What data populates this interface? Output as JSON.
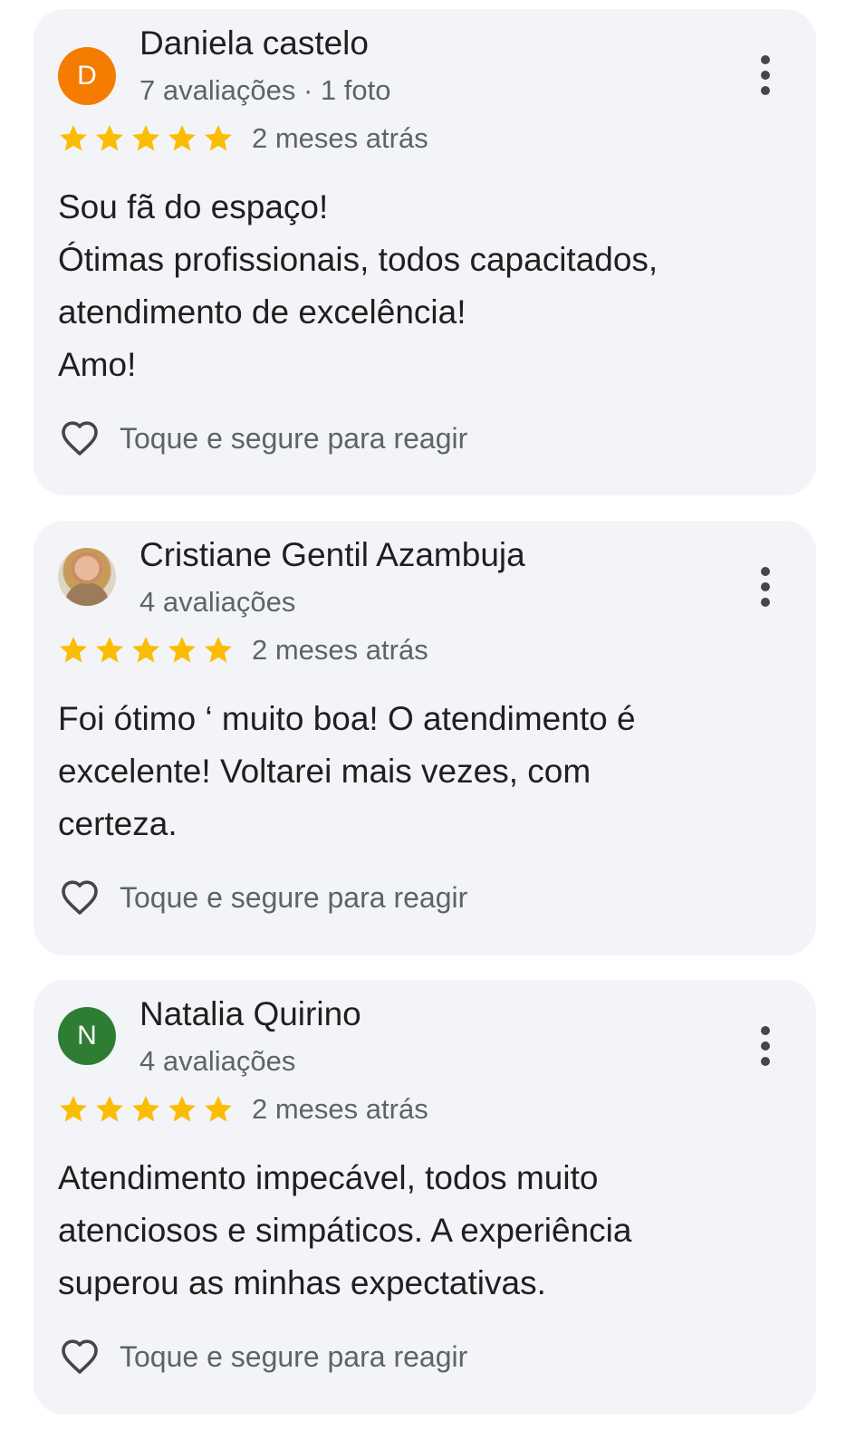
{
  "reviews": [
    {
      "reviewer_name": "Daniela castelo",
      "avatar_letter": "D",
      "avatar_color": "#f57c00",
      "meta": "7 avaliações · 1 foto",
      "rating": 5,
      "date": "2 meses atrás",
      "text_lines": [
        "Sou fã do espaço!",
        "Ótimas profissionais, todos capacitados,",
        "atendimento de excelência!",
        "Amo!"
      ],
      "react_label": "Toque e segure para reagir"
    },
    {
      "reviewer_name": "Cristiane Gentil Azambuja",
      "avatar_letter": "",
      "avatar_color": "#ded6c8",
      "meta": "4 avaliações",
      "rating": 5,
      "date": "2 meses atrás",
      "text_lines": [
        "Foi ótimo ‘ muito boa! O atendimento é",
        "excelente! Voltarei mais vezes, com",
        "certeza."
      ],
      "react_label": "Toque e segure para reagir"
    },
    {
      "reviewer_name": "Natalia Quirino",
      "avatar_letter": "N",
      "avatar_color": "#2e7d32",
      "meta": "4 avaliações",
      "rating": 5,
      "date": "2 meses atrás",
      "text_lines": [
        "Atendimento impecável, todos muito",
        "atenciosos e simpáticos. A experiência",
        "superou as minhas expectativas."
      ],
      "react_label": "Toque e segure para reagir"
    }
  ],
  "colors": {
    "card_background": "#f3f4f7",
    "star": "#fbbc04",
    "secondary_text": "#5f6368",
    "primary_text": "#1f1f1f"
  }
}
